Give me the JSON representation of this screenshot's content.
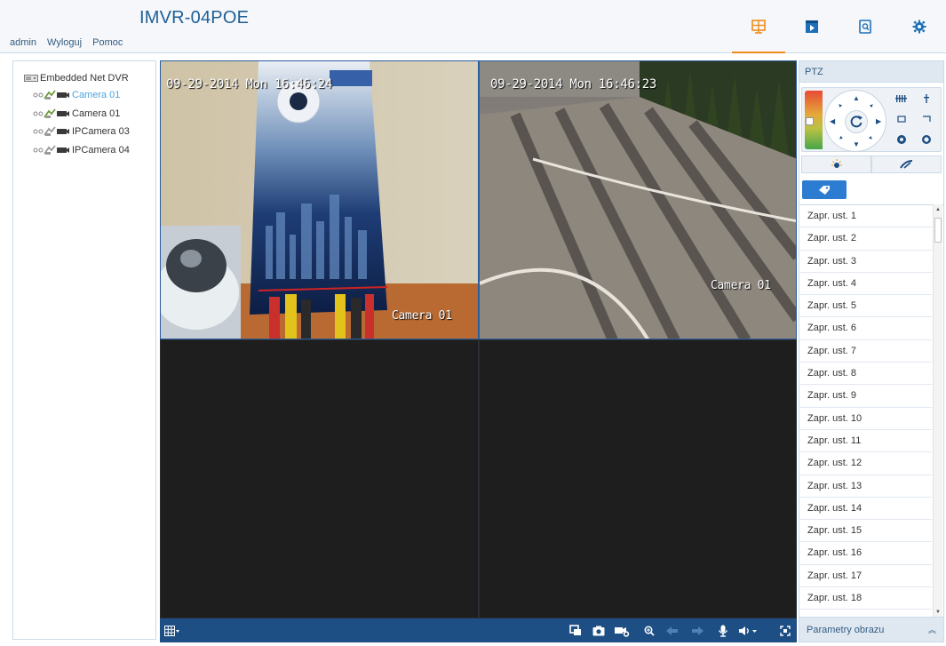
{
  "header": {
    "title": "IMVR-04POE",
    "user": "admin",
    "logout": "Wyloguj",
    "help": "Pomoc",
    "nav": [
      {
        "icon": "live-view-icon",
        "active": true
      },
      {
        "icon": "playback-icon",
        "active": false
      },
      {
        "icon": "log-search-icon",
        "active": false
      },
      {
        "icon": "settings-gear-icon",
        "active": false
      }
    ]
  },
  "tree": {
    "root": "Embedded Net DVR",
    "items": [
      {
        "label": "Camera 01",
        "selected": true
      },
      {
        "label": "Camera 01",
        "selected": false
      },
      {
        "label": "IPCamera 03",
        "selected": false
      },
      {
        "label": "IPCamera 04",
        "selected": false
      }
    ]
  },
  "video": {
    "tiles": [
      {
        "timestamp": "09-29-2014 Mon 16:46:24",
        "camera_label": "Camera 01"
      },
      {
        "timestamp": "09-29-2014 Mon 16:46:23",
        "camera_label": "Camera 01"
      }
    ]
  },
  "ptz": {
    "title": "PTZ",
    "presets": [
      "Zapr. ust. 1",
      "Zapr. ust. 2",
      "Zapr. ust. 3",
      "Zapr. ust. 4",
      "Zapr. ust. 5",
      "Zapr. ust. 6",
      "Zapr. ust. 7",
      "Zapr. ust. 8",
      "Zapr. ust. 9",
      "Zapr. ust. 10",
      "Zapr. ust. 11",
      "Zapr. ust. 12",
      "Zapr. ust. 13",
      "Zapr. ust. 14",
      "Zapr. ust. 15",
      "Zapr. ust. 16",
      "Zapr. ust. 17",
      "Zapr. ust. 18"
    ],
    "image_params": "Parametry obrazu"
  },
  "colors": {
    "accent": "#f08c1a",
    "toolbar": "#1d4e84",
    "selected_text": "#4ea2dd",
    "brand": "#1f5f95"
  }
}
